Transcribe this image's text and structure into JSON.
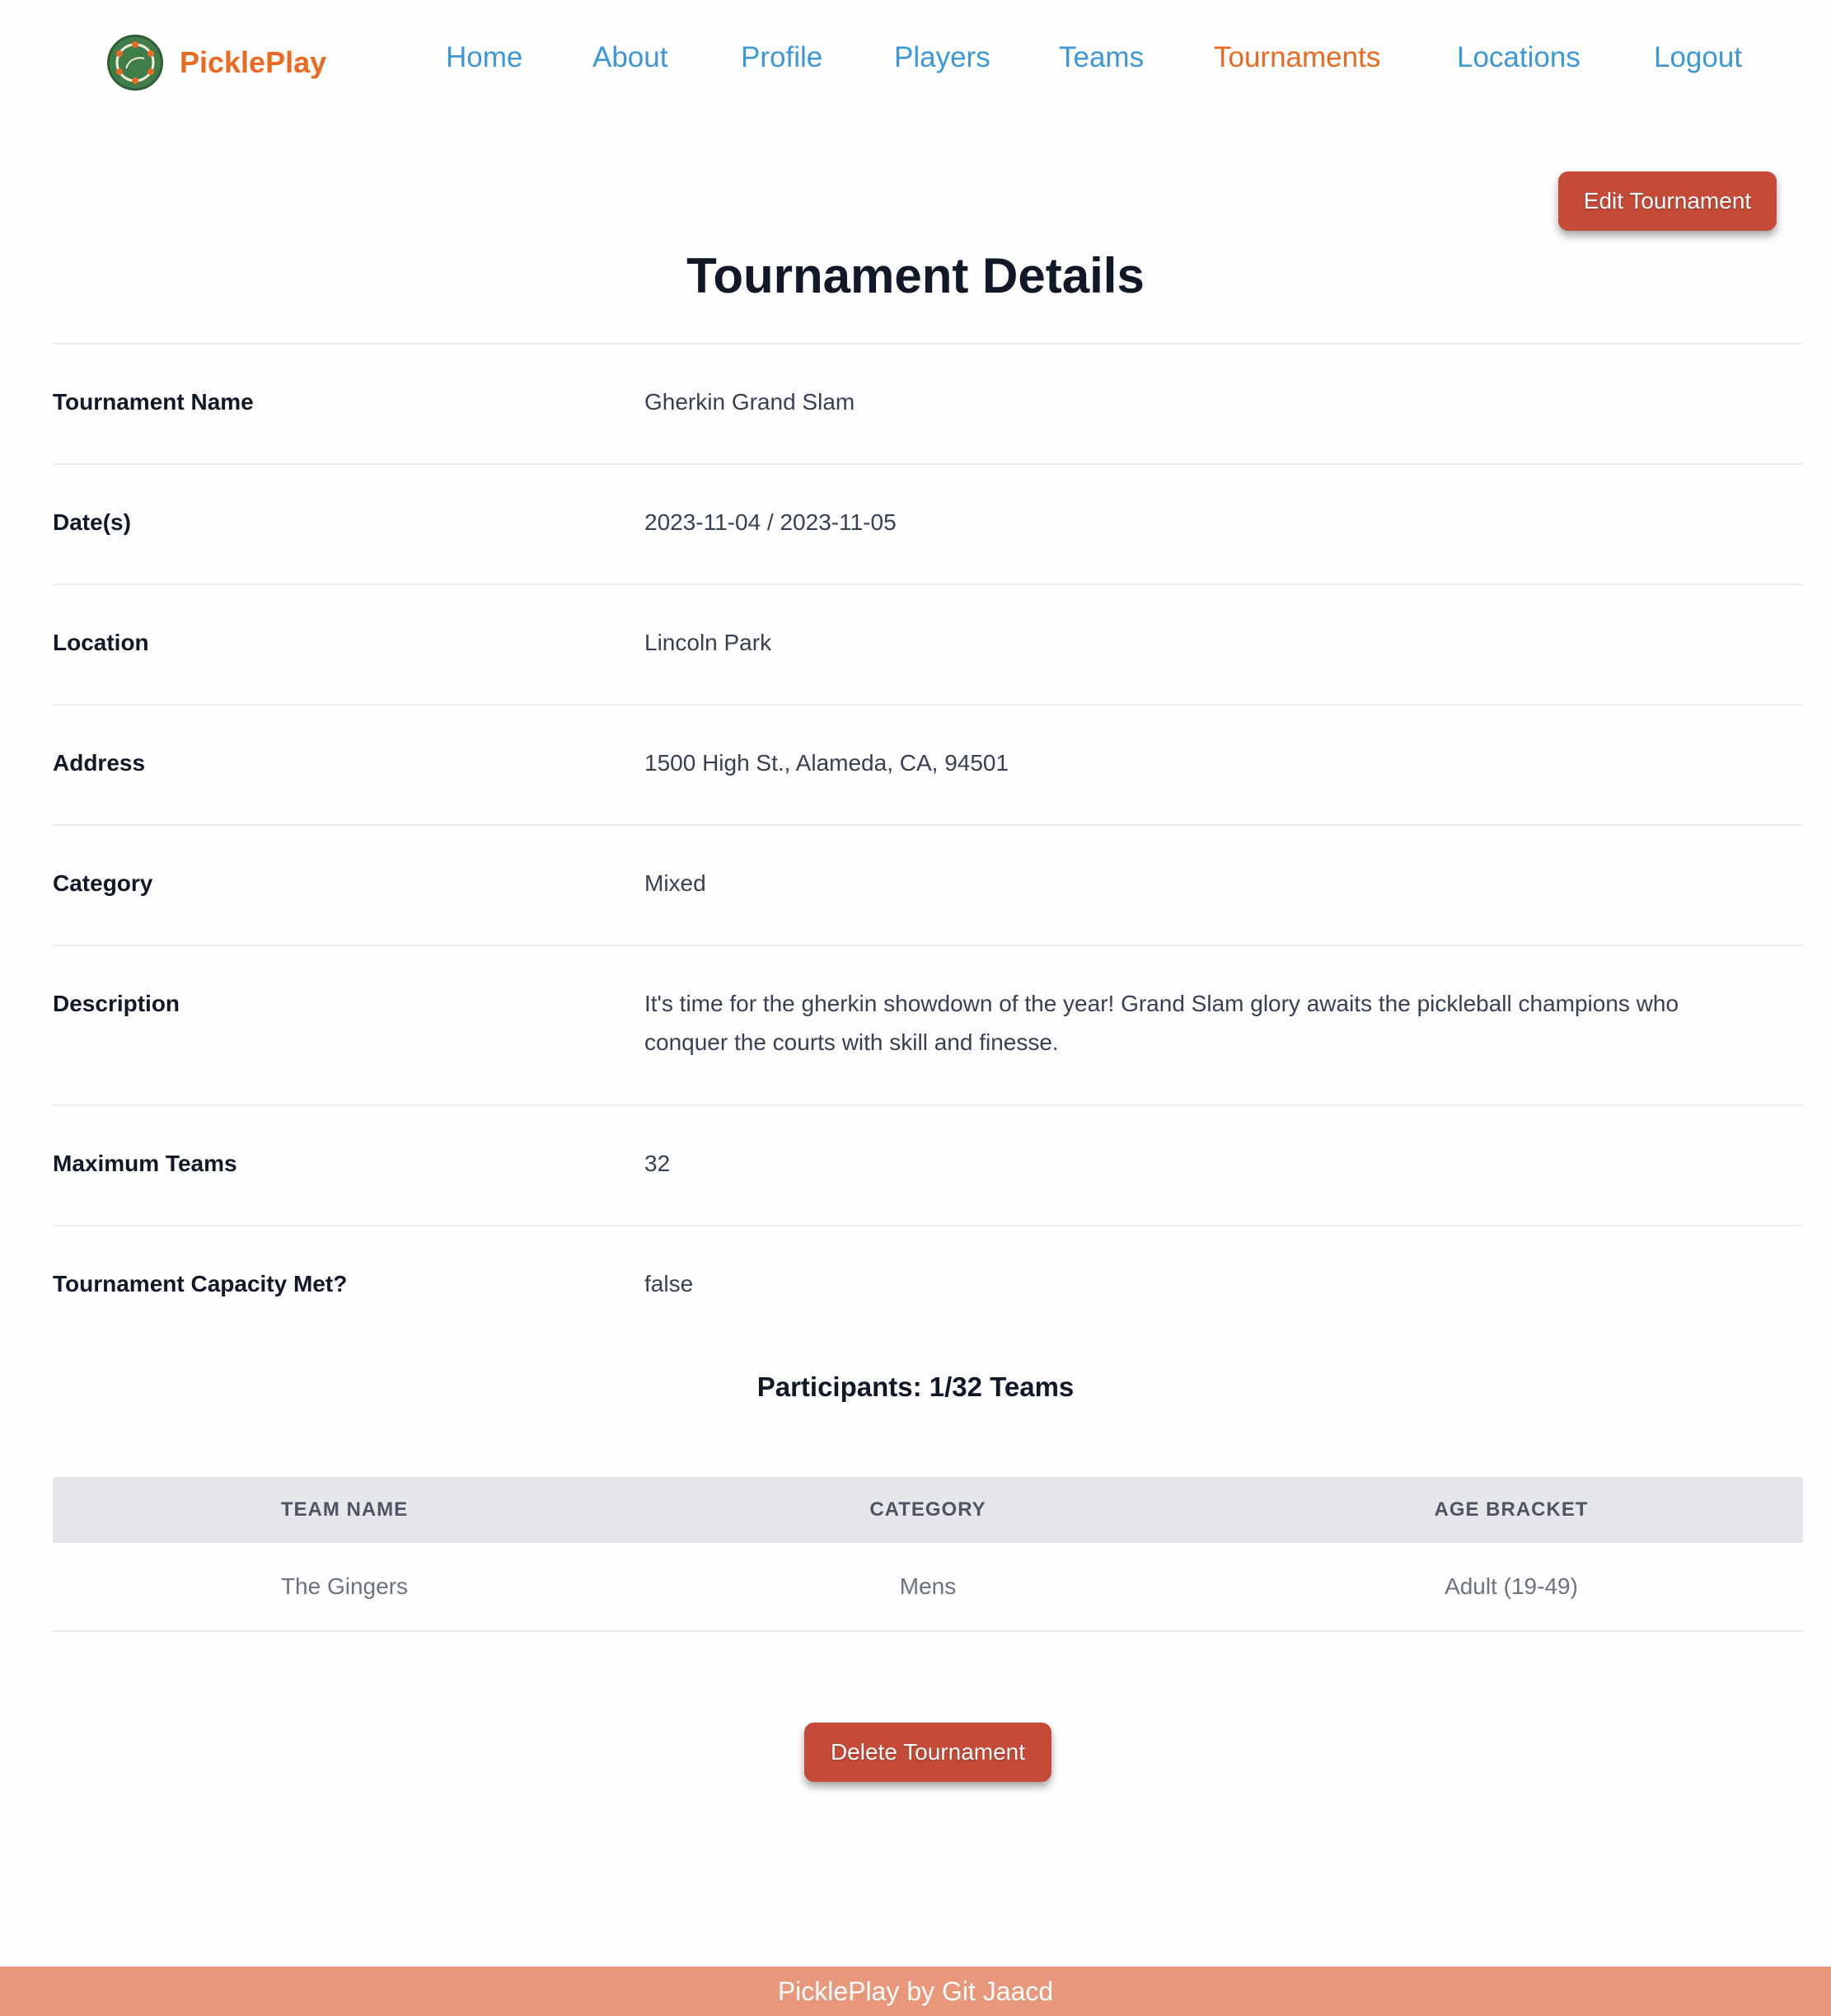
{
  "brand": {
    "name": "PicklePlay",
    "logo_icon": "pickleball-logo-icon"
  },
  "nav": {
    "items": [
      {
        "label": "Home",
        "active": false
      },
      {
        "label": "About",
        "active": false
      },
      {
        "label": "Profile",
        "active": false
      },
      {
        "label": "Players",
        "active": false
      },
      {
        "label": "Teams",
        "active": false
      },
      {
        "label": "Tournaments",
        "active": true
      },
      {
        "label": "Locations",
        "active": false
      },
      {
        "label": "Logout",
        "active": false
      }
    ]
  },
  "actions": {
    "edit_label": "Edit Tournament",
    "delete_label": "Delete Tournament"
  },
  "page": {
    "title": "Tournament Details"
  },
  "details": [
    {
      "label": "Tournament Name",
      "value": "Gherkin Grand Slam"
    },
    {
      "label": "Date(s)",
      "value": "2023-11-04 / 2023-11-05"
    },
    {
      "label": "Location",
      "value": "Lincoln Park"
    },
    {
      "label": "Address",
      "value": "1500 High St., Alameda, CA, 94501"
    },
    {
      "label": "Category",
      "value": "Mixed"
    },
    {
      "label": "Description",
      "value": "It's time for the gherkin showdown of the year! Grand Slam glory awaits the pickleball champions who conquer the courts with skill and finesse."
    },
    {
      "label": "Maximum Teams",
      "value": "32"
    },
    {
      "label": "Tournament Capacity Met?",
      "value": "false"
    }
  ],
  "participants": {
    "heading": "Participants: 1/32 Teams",
    "columns": [
      "TEAM NAME",
      "CATEGORY",
      "AGE BRACKET"
    ],
    "rows": [
      [
        "The Gingers",
        "Mens",
        "Adult (19-49)"
      ]
    ]
  },
  "footer": {
    "text": "PicklePlay by Git Jaacd"
  },
  "colors": {
    "accent": "#ea6a21",
    "link": "#3b97d6",
    "danger": "#c54a37",
    "footer": "#e8977a"
  }
}
